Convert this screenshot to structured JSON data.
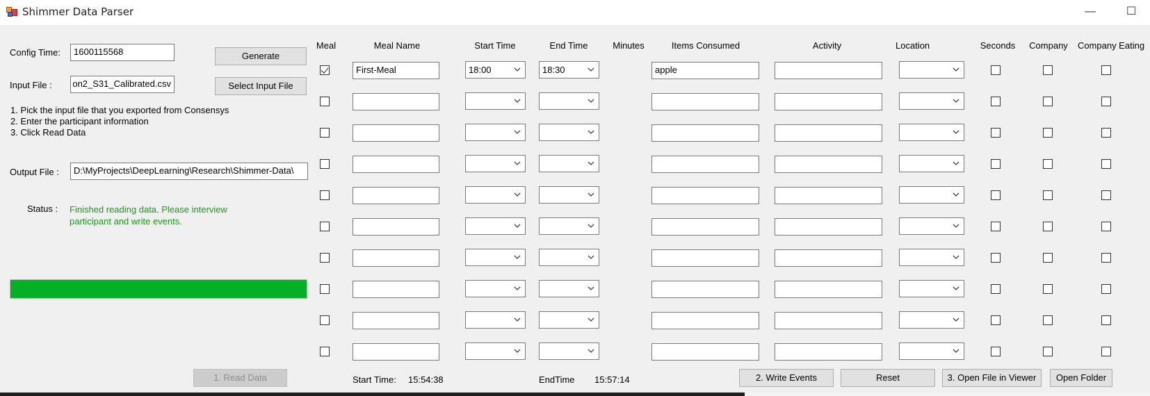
{
  "window": {
    "title": "Shimmer Data Parser",
    "minimize_glyph": "—",
    "maximize_glyph": "☐"
  },
  "left": {
    "config_time_label": "Config Time:",
    "config_time_value": "1600115568",
    "generate_label": "Generate",
    "input_file_label": "Input File :",
    "input_file_value": "on2_S31_Calibrated.csv",
    "select_input_label": "Select Input File",
    "instructions": [
      "1. Pick the input file that you exported from Consensys",
      "2. Enter the participant information",
      "3. Click Read Data"
    ],
    "output_file_label": "Output File :",
    "output_file_value": "D:\\MyProjects\\DeepLearning\\Research\\Shimmer-Data\\",
    "status_label": "Status :",
    "status_line1": "Finished reading data. Please interview",
    "status_line2": "participant and write events.",
    "progress_fraction": 1.0,
    "progress_color": "#06b025",
    "read_data_label": "1. Read Data"
  },
  "grid": {
    "headers": {
      "meal": "Meal",
      "meal_name": "Meal Name",
      "start_time": "Start Time",
      "end_time": "End Time",
      "minutes": "Minutes",
      "items": "Items Consumed",
      "activity": "Activity",
      "location": "Location",
      "seconds": "Seconds",
      "company": "Company",
      "company_eating": "Company Eating"
    },
    "rows": [
      {
        "meal": true,
        "meal_name": "First-Meal",
        "start": "18:00",
        "end": "18:30",
        "items": "apple",
        "activity": "",
        "location": "",
        "seconds": false,
        "company": false,
        "company_eating": false
      },
      {
        "meal": false,
        "meal_name": "",
        "start": "",
        "end": "",
        "items": "",
        "activity": "",
        "location": "",
        "seconds": false,
        "company": false,
        "company_eating": false
      },
      {
        "meal": false,
        "meal_name": "",
        "start": "",
        "end": "",
        "items": "",
        "activity": "",
        "location": "",
        "seconds": false,
        "company": false,
        "company_eating": false
      },
      {
        "meal": false,
        "meal_name": "",
        "start": "",
        "end": "",
        "items": "",
        "activity": "",
        "location": "",
        "seconds": false,
        "company": false,
        "company_eating": false
      },
      {
        "meal": false,
        "meal_name": "",
        "start": "",
        "end": "",
        "items": "",
        "activity": "",
        "location": "",
        "seconds": false,
        "company": false,
        "company_eating": false
      },
      {
        "meal": false,
        "meal_name": "",
        "start": "",
        "end": "",
        "items": "",
        "activity": "",
        "location": "",
        "seconds": false,
        "company": false,
        "company_eating": false
      },
      {
        "meal": false,
        "meal_name": "",
        "start": "",
        "end": "",
        "items": "",
        "activity": "",
        "location": "",
        "seconds": false,
        "company": false,
        "company_eating": false
      },
      {
        "meal": false,
        "meal_name": "",
        "start": "",
        "end": "",
        "items": "",
        "activity": "",
        "location": "",
        "seconds": false,
        "company": false,
        "company_eating": false
      },
      {
        "meal": false,
        "meal_name": "",
        "start": "",
        "end": "",
        "items": "",
        "activity": "",
        "location": "",
        "seconds": false,
        "company": false,
        "company_eating": false
      },
      {
        "meal": false,
        "meal_name": "",
        "start": "",
        "end": "",
        "items": "",
        "activity": "",
        "location": "",
        "seconds": false,
        "company": false,
        "company_eating": false
      }
    ]
  },
  "footer": {
    "start_time_label": "Start Time:",
    "start_time_value": "15:54:38",
    "end_time_label": "EndTime",
    "end_time_value": "15:57:14",
    "write_events_label": "2. Write Events",
    "reset_label": "Reset",
    "open_viewer_label": "3. Open File in Viewer",
    "open_folder_label": "Open Folder"
  }
}
